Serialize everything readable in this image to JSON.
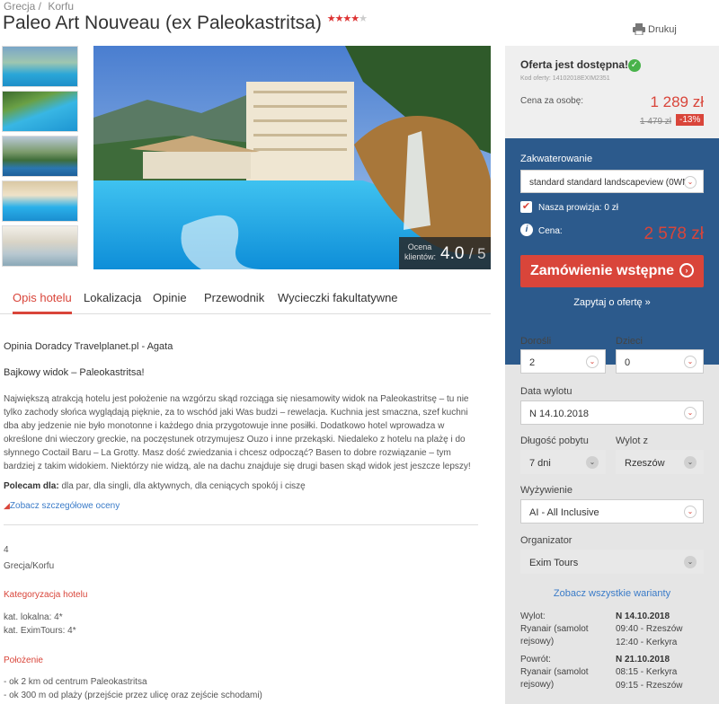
{
  "breadcrumbs": [
    "Grecja /",
    "Korfu"
  ],
  "hotel": {
    "name": "Paleo Art Nouveau (ex Paleokastritsa)",
    "stars": 4
  },
  "print_label": "Drukuj",
  "rating": {
    "label": "Ocena klientów:",
    "value": "4.0",
    "max": "/ 5"
  },
  "tabs": [
    "Opis hotelu",
    "Lokalizacja",
    "Opinie",
    "Przewodnik",
    "Wycieczki fakultatywne"
  ],
  "content": {
    "advisor": "Opinia Doradcy Travelplanet.pl - Agata",
    "subtitle": "Bajkowy widok – Paleokastritsa!",
    "description": "Największą atrakcją hotelu jest położenie na wzgórzu skąd rozciąga się niesamowity widok na Paleokastritsę – tu nie tylko zachody słońca wyglądają pięknie, za to wschód jaki Was budzi – rewelacja. Kuchnia jest smaczna, szef kuchni dba aby jedzenie nie było monotonne i każdego dnia przygotowuje inne posiłki. Dodatkowo hotel wprowadza w określone dni wieczory greckie, na poczęstunek otrzymujesz Ouzo i inne przekąski. Niedaleko z hotelu na plażę i do słynnego Coctail Baru – La Grotty. Masz dość zwiedzania i chcesz odpocząć? Basen to dobre rozwiązanie – tym bardziej z takim widokiem. Niektórzy nie widzą, ale na dachu znajduje się drugi basen skąd widok jest jeszcze lepszy!",
    "recommend_label": "Polecam dla:",
    "recommend_text": " dla par, dla singli, dla aktywnych, dla ceniących spokój i ciszę",
    "detailed_link": "Zobacz szczegółowe oceny",
    "stars_num": "4",
    "location": "Grecja/Korfu",
    "category_heading": "Kategoryzacja hotelu",
    "local_cat": "kat. lokalna: 4*",
    "exim_cat": "kat. EximTours: 4*",
    "position_heading": "Położenie",
    "pos1": "- ok 2 km od centrum Paleokastritsa",
    "pos2": "- ok 300 m od plaży (przejście przez ulicę oraz zejście schodami)"
  },
  "offer": {
    "available": "Oferta jest dostępna!",
    "code": "Kod oferty: 14102018EXIM2351",
    "per_person_label": "Cena za osobę:",
    "price": "1 289 zł",
    "old_price": "1 479 zł",
    "discount": "-13%"
  },
  "booking": {
    "accommodation_label": "Zakwaterowanie",
    "accommodation_value": "standard standard landscapeview (0WN)",
    "commission": "Nasza prowizja: 0 zł",
    "price_label": "Cena:",
    "total_price": "2 578 zł",
    "order_button": "Zamówienie wstępne",
    "ask_link": "Zapytaj o ofertę »"
  },
  "form": {
    "adults_label": "Dorośli",
    "adults": "2",
    "children_label": "Dzieci",
    "children": "0",
    "departure_label": "Data wylotu",
    "departure": "N 14.10.2018",
    "duration_label": "Długość pobytu",
    "duration": "7 dni",
    "from_label": "Wylot z",
    "from": "Rzeszów",
    "board_label": "Wyżywienie",
    "board": "AI - All Inclusive",
    "organizer_label": "Organizator",
    "organizer": "Exim Tours",
    "variants_link": "Zobacz wszystkie warianty"
  },
  "flights": {
    "out_label": "Wylot:",
    "out_date": "N 14.10.2018",
    "out_carrier": "Ryanair (samolot rejsowy)",
    "out_t1": "09:40 - Rzeszów",
    "out_t2": "12:40 - Kerkyra",
    "ret_label": "Powrót:",
    "ret_date": "N 21.10.2018",
    "ret_carrier": "Ryanair (samolot rejsowy)",
    "ret_t1": "08:15 - Kerkyra",
    "ret_t2": "09:15 - Rzeszów"
  }
}
